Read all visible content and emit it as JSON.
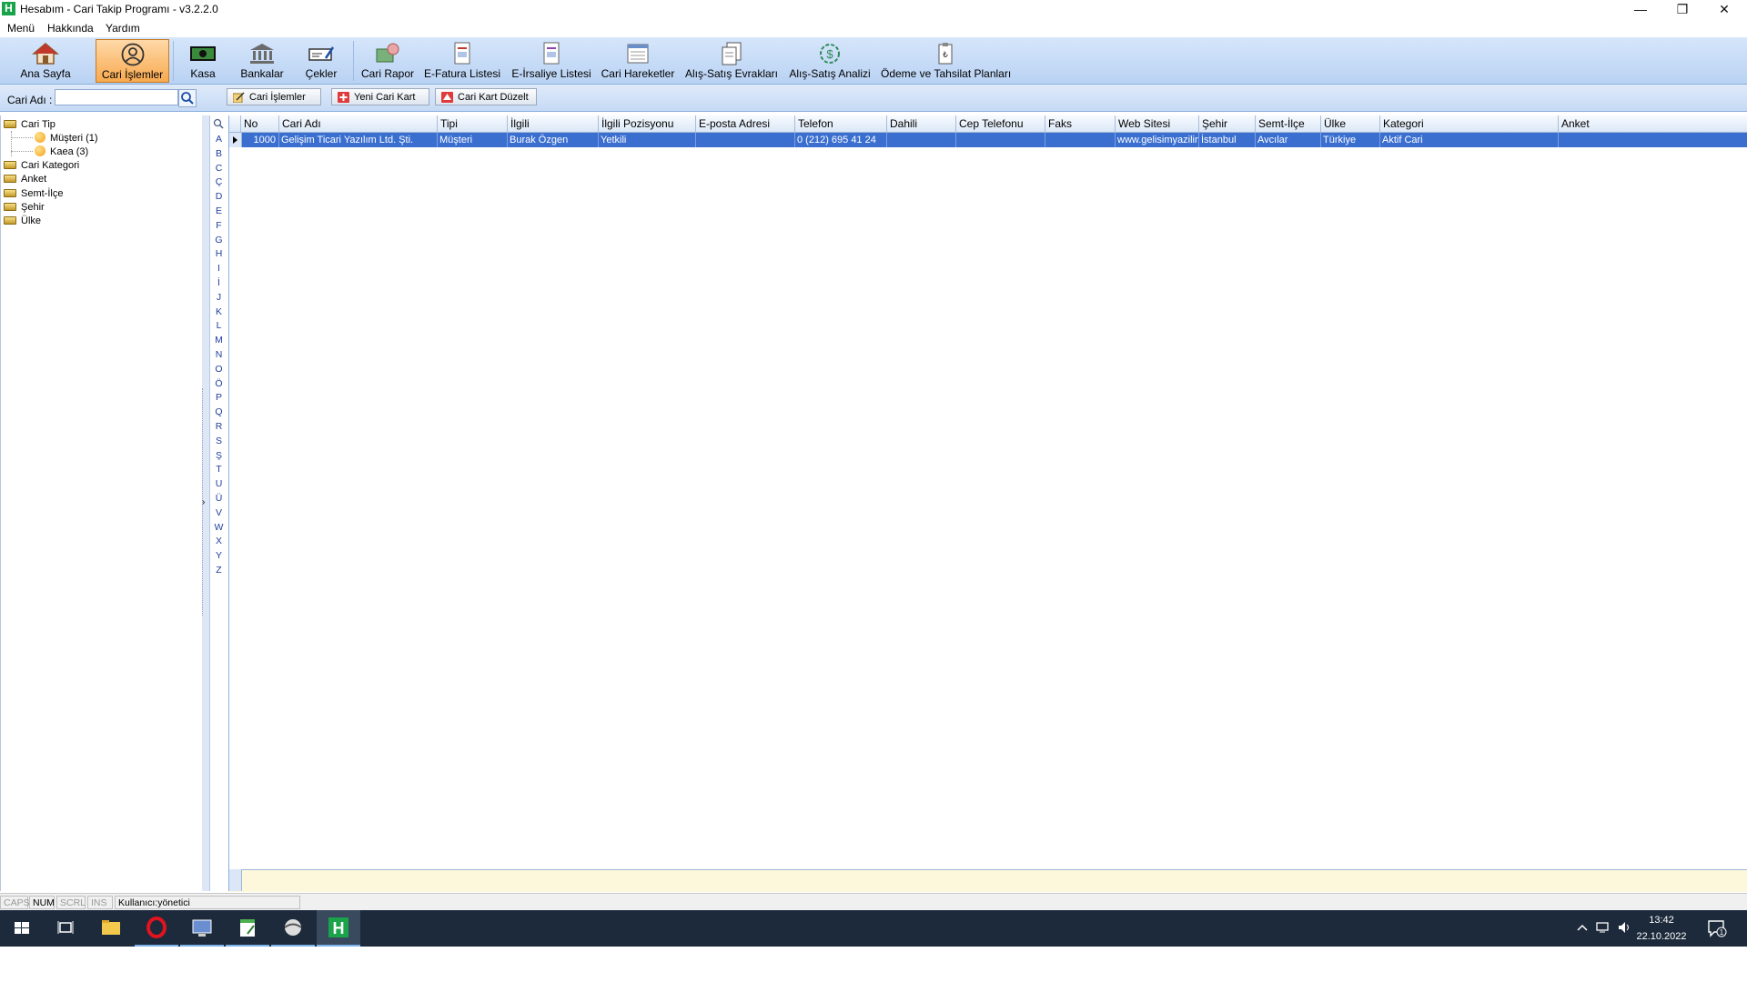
{
  "window": {
    "title": "Hesabım - Cari Takip Programı - v3.2.2.0",
    "app_icon_letter": "H",
    "controls": {
      "minimize": "—",
      "restore": "❐",
      "close": "✕"
    }
  },
  "menu": [
    "Menü",
    "Hakkında",
    "Yardım"
  ],
  "ribbon": {
    "buttons": [
      {
        "label": "Ana Sayfa",
        "icon": "home-icon"
      },
      {
        "label": "Cari İşlemler",
        "icon": "user-icon",
        "active": true
      },
      {
        "label": "Kasa",
        "icon": "cash-icon"
      },
      {
        "label": "Bankalar",
        "icon": "bank-icon"
      },
      {
        "label": "Çekler",
        "icon": "cheque-icon"
      },
      {
        "label": "Cari Rapor",
        "icon": "report-icon"
      },
      {
        "label": "E-Fatura Listesi",
        "icon": "invoice-icon"
      },
      {
        "label": "E-İrsaliye Listesi",
        "icon": "waybill-icon"
      },
      {
        "label": "Cari Hareketler",
        "icon": "transactions-icon"
      },
      {
        "label": "Alış-Satış Evrakları",
        "icon": "documents-icon"
      },
      {
        "label": "Alış-Satış Analizi",
        "icon": "analysis-icon"
      },
      {
        "label": "Ödeme ve Tahsilat Planları",
        "icon": "clipboard-icon"
      }
    ]
  },
  "search": {
    "label": "Cari Adı :",
    "value": "",
    "buttons": [
      "Cari İşlemler",
      "Yeni Cari Kart",
      "Cari Kart Düzelt"
    ]
  },
  "tree": {
    "root": "Cari Tip",
    "children": [
      "Müşteri (1)",
      "Kaea (3)"
    ],
    "other": [
      "Cari Kategori",
      "Anket",
      "Semt-İlçe",
      "Şehir",
      "Ülke"
    ]
  },
  "alphabet": [
    "A",
    "B",
    "C",
    "Ç",
    "D",
    "E",
    "F",
    "G",
    "H",
    "I",
    "İ",
    "J",
    "K",
    "L",
    "M",
    "N",
    "O",
    "Ö",
    "P",
    "Q",
    "R",
    "S",
    "Ş",
    "T",
    "U",
    "Ü",
    "V",
    "W",
    "X",
    "Y",
    "Z"
  ],
  "grid": {
    "columns": [
      "No",
      "Cari Adı",
      "Tipi",
      "İlgili",
      "İlgili Pozisyonu",
      "E-posta Adresi",
      "Telefon",
      "Dahili",
      "Cep Telefonu",
      "Faks",
      "Web Sitesi",
      "Şehir",
      "Semt-İlçe",
      "Ülke",
      "Kategori",
      "Anket"
    ],
    "rows": [
      [
        "1000",
        "Gelişim Ticari Yazılım Ltd. Şti.",
        "Müşteri",
        "Burak Özgen",
        "Yetkili",
        "",
        "0 (212) 695 41 24",
        "",
        "",
        "",
        "www.gelisimyazilim",
        "İstanbul",
        "Avcılar",
        "Türkiye",
        "Aktif Cari",
        ""
      ]
    ]
  },
  "status": {
    "caps": "CAPS",
    "num": "NUM",
    "scrl": "SCRL",
    "ins": "INS",
    "user": "Kullanıcı:yönetici"
  },
  "taskbar": {
    "time": "13:42",
    "date": "22.10.2022",
    "notification_count": "1"
  },
  "colors": {
    "ribbon": "#c8dcf6",
    "active_button": "#f7a94f",
    "selected_row": "#3a6fd0",
    "taskbar": "#1c2a3b"
  }
}
